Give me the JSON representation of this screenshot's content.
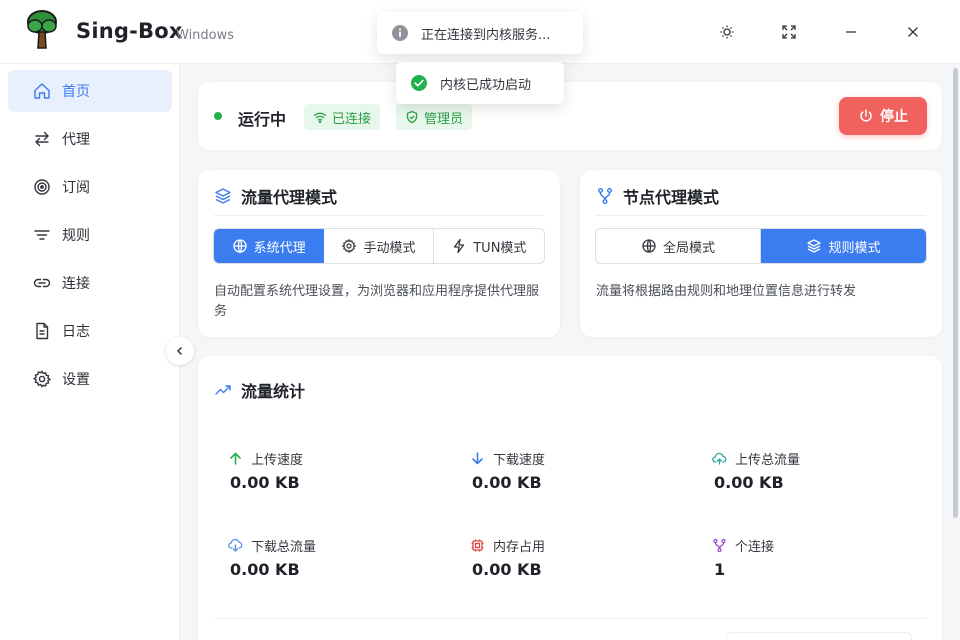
{
  "app": {
    "title": "Sing-Box",
    "subtitle": "Windows"
  },
  "toasts": {
    "info": "正在连接到内核服务...",
    "success": "内核已成功启动"
  },
  "sidebar": {
    "items": [
      {
        "label": "首页",
        "icon": "home-icon",
        "active": true
      },
      {
        "label": "代理",
        "icon": "swap-icon"
      },
      {
        "label": "订阅",
        "icon": "rss-icon"
      },
      {
        "label": "规则",
        "icon": "filter-icon"
      },
      {
        "label": "连接",
        "icon": "link-icon"
      },
      {
        "label": "日志",
        "icon": "file-icon"
      },
      {
        "label": "设置",
        "icon": "gear-icon"
      }
    ]
  },
  "status": {
    "running": "运行中",
    "connected": "已连接",
    "admin": "管理员",
    "stop": "停止"
  },
  "traffic_mode": {
    "title": "流量代理模式",
    "options": [
      "系统代理",
      "手动模式",
      "TUN模式"
    ],
    "selected": "系统代理",
    "description": "自动配置系统代理设置，为浏览器和应用程序提供代理服务"
  },
  "node_mode": {
    "title": "节点代理模式",
    "options": [
      "全局模式",
      "规则模式"
    ],
    "selected": "规则模式",
    "description": "流量将根据路由规则和地理位置信息进行转发"
  },
  "stats": {
    "title": "流量统计",
    "upload_speed": {
      "label": "上传速度",
      "value": "0.00 KB"
    },
    "download_speed": {
      "label": "下载速度",
      "value": "0.00 KB"
    },
    "upload_total": {
      "label": "上传总流量",
      "value": "0.00 KB"
    },
    "download_total": {
      "label": "下载总流量",
      "value": "0.00 KB"
    },
    "memory": {
      "label": "内存占用",
      "value": "0.00 KB"
    },
    "connections": {
      "label": "个连接",
      "value": "1"
    }
  },
  "colors": {
    "accent": "#3b7cf1",
    "success": "#22b14c",
    "danger": "#f0625e"
  }
}
